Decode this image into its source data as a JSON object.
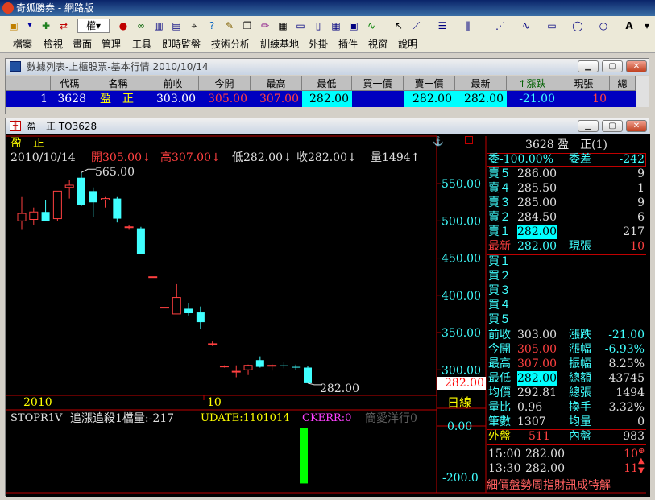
{
  "app": {
    "title": "奇狐勝券 - 網路版"
  },
  "menu": [
    "檔案",
    "檢視",
    "畫面",
    "管理",
    "工具",
    "即時監盤",
    "技術分析",
    "訓練基地",
    "外掛",
    "插件",
    "視窗",
    "說明"
  ],
  "toolbar": {
    "dropdown_label": "權"
  },
  "list_window": {
    "title": "數據列表-上櫃股票-基本行情 2010/10/14",
    "headers": [
      "代碼",
      "名稱",
      "前收",
      "今開",
      "最高",
      "最低",
      "買一價",
      "賣一價",
      "最新",
      "↑漲跌",
      "現張",
      "總"
    ],
    "row": {
      "idx": "1",
      "code": "3628",
      "name": "盈　正",
      "prev": "303.00",
      "open": "305.00",
      "high": "307.00",
      "low": "282.00",
      "bid": "",
      "ask": "282.00",
      "last": "282.00",
      "chg": "-21.00",
      "vol": "10"
    }
  },
  "chart_window": {
    "title": "盈　正 TO3628",
    "stock_name": "盈　正",
    "info_line": {
      "date": "2010/10/14",
      "open": "開305.00↓",
      "high": "高307.00↓",
      "low": "低282.00↓",
      "close": "收282.00↓",
      "vol": "量1494↑"
    },
    "high_annot": "565.00",
    "low_annot": "282.00",
    "price_badge": "282.00",
    "x_labels": [
      "2010",
      "10"
    ],
    "period_label": "日線",
    "indicator": {
      "name": "STOPR1V",
      "text": "追漲追殺1檔量:-217",
      "udate": "UDATE:1101014",
      "ckerr": "CKERR:0",
      "extra": "簡愛洋行0"
    },
    "ind_axis": [
      "0.00",
      "-200.0"
    ]
  },
  "chart_data": {
    "type": "candlestick",
    "yticks": [
      "550.00",
      "500.00",
      "450.00",
      "400.00",
      "350.00",
      "300.00"
    ],
    "ylim": [
      270,
      575
    ],
    "candles": [
      {
        "o": 500,
        "h": 532,
        "l": 488,
        "c": 510
      },
      {
        "o": 502,
        "h": 518,
        "l": 495,
        "c": 512
      },
      {
        "o": 512,
        "h": 528,
        "l": 500,
        "c": 500
      },
      {
        "o": 503,
        "h": 540,
        "l": 500,
        "c": 540
      },
      {
        "o": 545,
        "h": 555,
        "l": 530,
        "c": 548
      },
      {
        "o": 558,
        "h": 565,
        "l": 520,
        "c": 522
      },
      {
        "o": 540,
        "h": 545,
        "l": 505,
        "c": 525
      },
      {
        "o": 528,
        "h": 532,
        "l": 518,
        "c": 530
      },
      {
        "o": 530,
        "h": 532,
        "l": 498,
        "c": 503
      },
      {
        "o": 492,
        "h": 495,
        "l": 488,
        "c": 492
      },
      {
        "o": 490,
        "h": 492,
        "l": 455,
        "c": 455
      },
      {
        "o": 425,
        "h": 425,
        "l": 425,
        "c": 425
      },
      {
        "o": 384,
        "h": 384,
        "l": 383,
        "c": 384
      },
      {
        "o": 375,
        "h": 415,
        "l": 375,
        "c": 397
      },
      {
        "o": 382,
        "h": 390,
        "l": 373,
        "c": 376
      },
      {
        "o": 377,
        "h": 385,
        "l": 355,
        "c": 364
      },
      {
        "o": 335,
        "h": 338,
        "l": 332,
        "c": 335
      },
      {
        "o": 305,
        "h": 306,
        "l": 303,
        "c": 305
      },
      {
        "o": 298,
        "h": 306,
        "l": 290,
        "c": 298
      },
      {
        "o": 300,
        "h": 307,
        "l": 293,
        "c": 306
      },
      {
        "o": 313,
        "h": 318,
        "l": 303,
        "c": 304
      },
      {
        "o": 306,
        "h": 308,
        "l": 299,
        "c": 306
      },
      {
        "o": 306,
        "h": 310,
        "l": 302,
        "c": 305
      },
      {
        "o": 304,
        "h": 307,
        "l": 300,
        "c": 303
      },
      {
        "o": 303,
        "h": 305,
        "l": 282,
        "c": 282
      }
    ],
    "indicator_bar": -217
  },
  "quote": {
    "title": "3628 盈　正(1)",
    "wei_bi_label": "委-100.00%",
    "wei_cha_label": "委差",
    "wei_cha": "-242",
    "asks": [
      [
        "賣５",
        "286.00",
        "9"
      ],
      [
        "賣４",
        "285.50",
        "1"
      ],
      [
        "賣３",
        "285.00",
        "9"
      ],
      [
        "賣２",
        "284.50",
        "6"
      ],
      [
        "賣１",
        "282.00",
        "217"
      ]
    ],
    "last_label": "最新",
    "last": "282.00",
    "cur_vol_label": "現張",
    "cur_vol": "10",
    "bids": [
      "買１",
      "買２",
      "買３",
      "買４",
      "買５"
    ],
    "stats": [
      [
        "前收",
        "303.00",
        "漲跌",
        "-21.00"
      ],
      [
        "今開",
        "305.00",
        "漲幅",
        "-6.93%"
      ],
      [
        "最高",
        "307.00",
        "振幅",
        "8.25%"
      ],
      [
        "最低",
        "282.00",
        "總額",
        "43745"
      ],
      [
        "均價",
        "292.81",
        "總張",
        "1494"
      ],
      [
        "量比",
        "0.96",
        "換手",
        "3.32%"
      ],
      [
        "筆數",
        "1307",
        "均量",
        "0"
      ]
    ],
    "outer_label": "外盤",
    "outer": "511",
    "inner_label": "內盤",
    "inner": "983",
    "ticks": [
      [
        "15:00",
        "282.00",
        "10"
      ],
      [
        "13:30",
        "282.00",
        "11"
      ]
    ],
    "tabs": "細價盤勢周指財訊成特解"
  }
}
